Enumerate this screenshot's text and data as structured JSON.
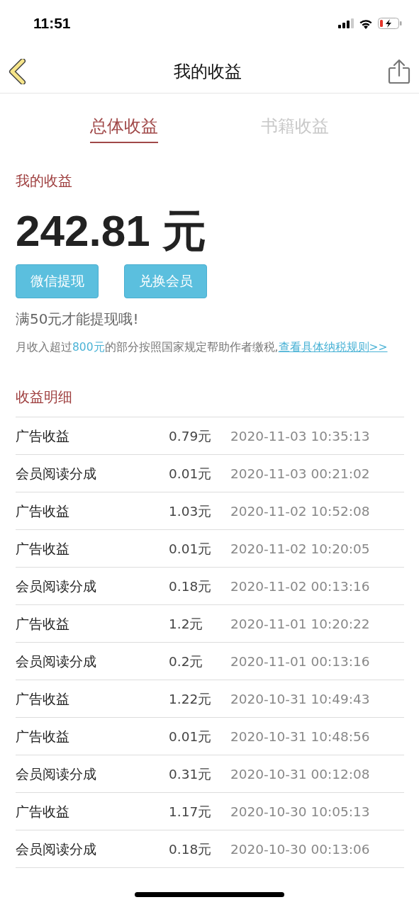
{
  "status_bar": {
    "time": "11:51"
  },
  "nav": {
    "title": "我的收益"
  },
  "tabs": [
    {
      "label": "总体收益",
      "selected": true
    },
    {
      "label": "书籍收益",
      "selected": false
    }
  ],
  "summary": {
    "heading": "我的收益",
    "amount": "242.81 元"
  },
  "buttons": [
    "微信提现",
    "兑换会员"
  ],
  "hint": "满50元才能提现哦!",
  "tax_notice": {
    "prefix": "月收入超过",
    "highlight": "800元",
    "suffix": "的部分按照国家规定帮助作者缴税,",
    "link": "查看具体纳税规则",
    "more_link": ">>"
  },
  "details": {
    "heading": "收益明细",
    "rows": [
      {
        "type": "广告收益",
        "amount": "0.79元",
        "time": "2020-11-03 10:35:13"
      },
      {
        "type": "会员阅读分成",
        "amount": "0.01元",
        "time": "2020-11-03 00:21:02"
      },
      {
        "type": "广告收益",
        "amount": "1.03元",
        "time": "2020-11-02 10:52:08"
      },
      {
        "type": "广告收益",
        "amount": "0.01元",
        "time": "2020-11-02 10:20:05"
      },
      {
        "type": "会员阅读分成",
        "amount": "0.18元",
        "time": "2020-11-02 00:13:16"
      },
      {
        "type": "广告收益",
        "amount": "1.2元",
        "time": "2020-11-01 10:20:22"
      },
      {
        "type": "会员阅读分成",
        "amount": "0.2元",
        "time": "2020-11-01 00:13:16"
      },
      {
        "type": "广告收益",
        "amount": "1.22元",
        "time": "2020-10-31 10:49:43"
      },
      {
        "type": "广告收益",
        "amount": "0.01元",
        "time": "2020-10-31 10:48:56"
      },
      {
        "type": "会员阅读分成",
        "amount": "0.31元",
        "time": "2020-10-31 00:12:08"
      },
      {
        "type": "广告收益",
        "amount": "1.17元",
        "time": "2020-10-30 10:05:13"
      },
      {
        "type": "会员阅读分成",
        "amount": "0.18元",
        "time": "2020-10-30 00:13:06"
      }
    ]
  }
}
